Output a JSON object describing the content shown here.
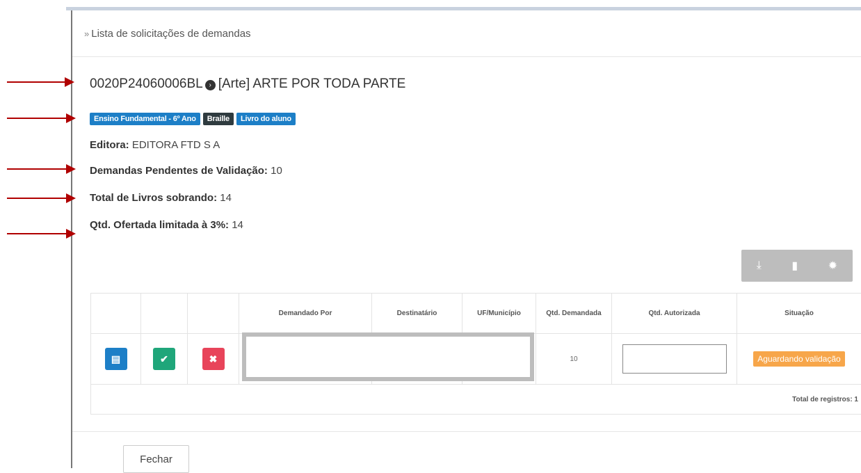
{
  "breadcrumb": {
    "label": "Lista de solicitações de demandas"
  },
  "header": {
    "code": "0020P24060006BL",
    "title": "[Arte] ARTE POR TODA PARTE",
    "badges": [
      "Ensino Fundamental - 6º Ano",
      "Braille",
      "Livro do aluno"
    ]
  },
  "info": {
    "editora_label": "Editora:",
    "editora_value": "EDITORA FTD S A",
    "pendentes_label": "Demandas Pendentes de Validação:",
    "pendentes_value": "10",
    "sobrando_label": "Total de Livros sobrando:",
    "sobrando_value": "14",
    "ofertada_label": "Qtd. Ofertada limitada à 3%:",
    "ofertada_value": "14"
  },
  "toolbar": {
    "icons": [
      "download-icon",
      "file-icon",
      "gear-icon"
    ]
  },
  "table": {
    "columns": [
      "Demandado Por",
      "Destinatário",
      "UF/Município",
      "Qtd. Demandada",
      "Qtd. Autorizada",
      "Situação"
    ],
    "rows": [
      {
        "qtd_demandada": "10",
        "qtd_autorizada": "",
        "situacao": "Aguardando validação"
      }
    ],
    "footer": "Total de registros: 1"
  },
  "actions": {
    "close_label": "Fechar"
  },
  "colors": {
    "primary": "#1d7fc7",
    "success": "#1fa67a",
    "danger": "#e8445a",
    "warning": "#f7a64a",
    "annotation": "#b00000"
  }
}
